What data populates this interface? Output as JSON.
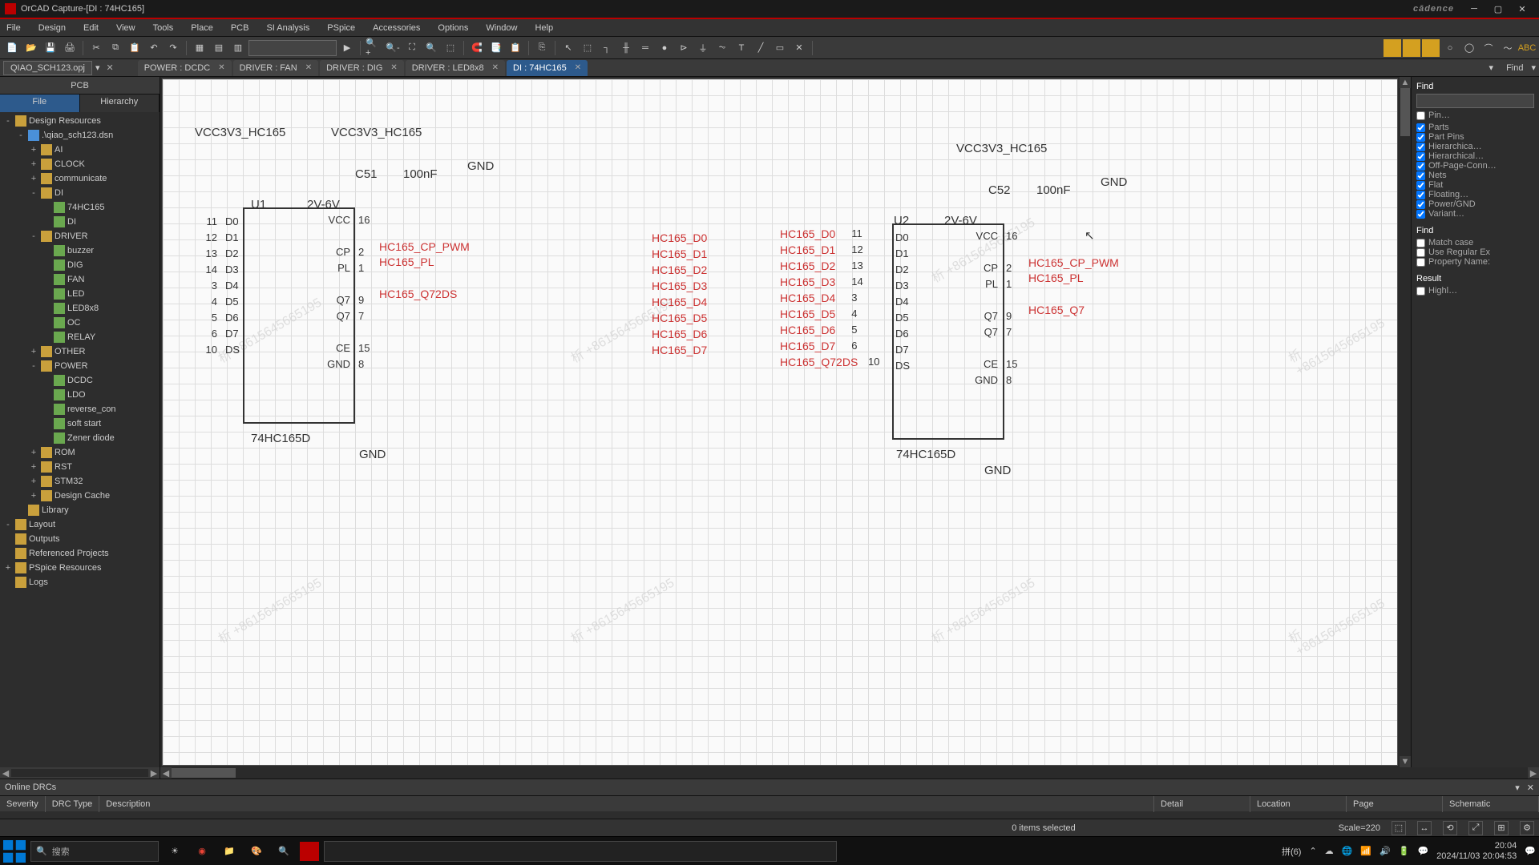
{
  "window": {
    "title": "OrCAD Capture-[DI : 74HC165]",
    "brand": "cādence"
  },
  "menu": [
    "File",
    "Design",
    "Edit",
    "View",
    "Tools",
    "Place",
    "PCB",
    "SI Analysis",
    "PSpice",
    "Accessories",
    "Options",
    "Window",
    "Help"
  ],
  "opj": {
    "name": "QIAO_SCH123.opj"
  },
  "tabs": [
    {
      "label": "POWER : DCDC",
      "sel": false
    },
    {
      "label": "DRIVER : FAN",
      "sel": false
    },
    {
      "label": "DRIVER : DIG",
      "sel": false
    },
    {
      "label": "DRIVER : LED8x8",
      "sel": false
    },
    {
      "label": "DI : 74HC165",
      "sel": true
    }
  ],
  "projpane": {
    "title": "PCB",
    "tab_file": "File",
    "tab_hier": "Hierarchy",
    "tree": [
      {
        "ind": 0,
        "exp": "-",
        "ico": "folder",
        "lbl": "Design Resources"
      },
      {
        "ind": 1,
        "exp": "-",
        "ico": "dsn",
        "lbl": ".\\qiao_sch123.dsn"
      },
      {
        "ind": 2,
        "exp": "+",
        "ico": "folder",
        "lbl": "AI"
      },
      {
        "ind": 2,
        "exp": "+",
        "ico": "folder",
        "lbl": "CLOCK"
      },
      {
        "ind": 2,
        "exp": "+",
        "ico": "folder",
        "lbl": "communicate"
      },
      {
        "ind": 2,
        "exp": "-",
        "ico": "folder",
        "lbl": "DI"
      },
      {
        "ind": 3,
        "exp": "",
        "ico": "page",
        "lbl": "74HC165"
      },
      {
        "ind": 3,
        "exp": "",
        "ico": "page",
        "lbl": "DI"
      },
      {
        "ind": 2,
        "exp": "-",
        "ico": "folder",
        "lbl": "DRIVER"
      },
      {
        "ind": 3,
        "exp": "",
        "ico": "page",
        "lbl": "buzzer"
      },
      {
        "ind": 3,
        "exp": "",
        "ico": "page",
        "lbl": "DIG"
      },
      {
        "ind": 3,
        "exp": "",
        "ico": "page",
        "lbl": "FAN"
      },
      {
        "ind": 3,
        "exp": "",
        "ico": "page",
        "lbl": "LED"
      },
      {
        "ind": 3,
        "exp": "",
        "ico": "page",
        "lbl": "LED8x8"
      },
      {
        "ind": 3,
        "exp": "",
        "ico": "page",
        "lbl": "OC"
      },
      {
        "ind": 3,
        "exp": "",
        "ico": "page",
        "lbl": "RELAY"
      },
      {
        "ind": 2,
        "exp": "+",
        "ico": "folder",
        "lbl": "OTHER"
      },
      {
        "ind": 2,
        "exp": "-",
        "ico": "folder",
        "lbl": "POWER"
      },
      {
        "ind": 3,
        "exp": "",
        "ico": "page",
        "lbl": "DCDC"
      },
      {
        "ind": 3,
        "exp": "",
        "ico": "page",
        "lbl": "LDO"
      },
      {
        "ind": 3,
        "exp": "",
        "ico": "page",
        "lbl": "reverse_con"
      },
      {
        "ind": 3,
        "exp": "",
        "ico": "page",
        "lbl": "soft start"
      },
      {
        "ind": 3,
        "exp": "",
        "ico": "page",
        "lbl": "Zener diode"
      },
      {
        "ind": 2,
        "exp": "+",
        "ico": "folder",
        "lbl": "ROM"
      },
      {
        "ind": 2,
        "exp": "+",
        "ico": "folder",
        "lbl": "RST"
      },
      {
        "ind": 2,
        "exp": "+",
        "ico": "folder",
        "lbl": "STM32"
      },
      {
        "ind": 2,
        "exp": "+",
        "ico": "folder",
        "lbl": "Design Cache"
      },
      {
        "ind": 1,
        "exp": "",
        "ico": "folder",
        "lbl": "Library"
      },
      {
        "ind": 0,
        "exp": "-",
        "ico": "folder",
        "lbl": "Layout"
      },
      {
        "ind": 0,
        "exp": "",
        "ico": "folder",
        "lbl": "Outputs"
      },
      {
        "ind": 0,
        "exp": "",
        "ico": "folder",
        "lbl": "Referenced Projects"
      },
      {
        "ind": 0,
        "exp": "+",
        "ico": "folder",
        "lbl": "PSpice Resources"
      },
      {
        "ind": 0,
        "exp": "",
        "ico": "folder",
        "lbl": "Logs"
      }
    ]
  },
  "find_header": "Find",
  "find": {
    "title": "Find",
    "pin": "Pin…",
    "checks": [
      "Parts",
      "Part Pins",
      "Hierarchica…",
      "Hierarchical…",
      "Off-Page-Conn…",
      "Nets",
      "Flat",
      "Floating…",
      "Power/GND",
      "Variant…"
    ],
    "title2": "Find",
    "opts": [
      "Match case",
      "Use Regular Ex",
      "Property Name:"
    ],
    "title3": "Result",
    "res": "Highl…"
  },
  "drc": {
    "title": "Online DRCs",
    "cols": [
      "Severity",
      "DRC Type",
      "Description",
      "Detail",
      "Location",
      "Page",
      "Schematic"
    ]
  },
  "status": {
    "sel": "0 items selected",
    "scale": "Scale=220"
  },
  "sch": {
    "pwr_u1": "VCC3V3_HC165",
    "pwr_c1": "VCC3V3_HC165",
    "pwr_u2": "VCC3V3_HC165",
    "c51": "C51",
    "c51v": "100nF",
    "gnd1": "GND",
    "c52": "C52",
    "c52v": "100nF",
    "gnd2": "GND",
    "u1": "U1",
    "u1v": "2V-6V",
    "u1part": "74HC165D",
    "u1gnd": "GND",
    "u2": "U2",
    "u2v": "2V-6V",
    "u2part": "74HC165D",
    "u2gnd": "GND",
    "u1pins_l": [
      [
        "11",
        "D0"
      ],
      [
        "12",
        "D1"
      ],
      [
        "13",
        "D2"
      ],
      [
        "14",
        "D3"
      ],
      [
        "3",
        "D4"
      ],
      [
        "4",
        "D5"
      ],
      [
        "5",
        "D6"
      ],
      [
        "6",
        "D7"
      ],
      [
        "10",
        "DS"
      ]
    ],
    "u1pins_r": [
      [
        "16",
        "VCC"
      ],
      [
        "2",
        "CP"
      ],
      [
        "1",
        "PL"
      ],
      [
        "9",
        "Q7"
      ],
      [
        "7",
        "Q7"
      ],
      [
        "15",
        "CE"
      ],
      [
        "8",
        "GND"
      ]
    ],
    "u2pins_l": [
      [
        "11",
        "D0"
      ],
      [
        "12",
        "D1"
      ],
      [
        "13",
        "D2"
      ],
      [
        "14",
        "D3"
      ],
      [
        "3",
        "D4"
      ],
      [
        "4",
        "D5"
      ],
      [
        "5",
        "D6"
      ],
      [
        "6",
        "D7"
      ],
      [
        "10",
        "DS"
      ]
    ],
    "u2pins_r": [
      [
        "16",
        "VCC"
      ],
      [
        "2",
        "CP"
      ],
      [
        "1",
        "PL"
      ],
      [
        "9",
        "Q7"
      ],
      [
        "7",
        "Q7"
      ],
      [
        "15",
        "CE"
      ],
      [
        "8",
        "GND"
      ]
    ],
    "nets_u1r": [
      "HC165_CP_PWM",
      "HC165_PL",
      "HC165_Q72DS"
    ],
    "nets_u2r": [
      "HC165_CP_PWM",
      "HC165_PL",
      "HC165_Q7"
    ],
    "nets_mid_l": [
      "HC165_D0",
      "HC165_D1",
      "HC165_D2",
      "HC165_D3",
      "HC165_D4",
      "HC165_D5",
      "HC165_D6",
      "HC165_D7"
    ],
    "nets_mid_r": [
      "HC165_D0",
      "HC165_D1",
      "HC165_D2",
      "HC165_D3",
      "HC165_D4",
      "HC165_D5",
      "HC165_D6",
      "HC165_D7"
    ],
    "net_ds": "HC165_Q72DS"
  },
  "taskbar": {
    "search": "搜索",
    "ime": "拼(6)",
    "time": "20:04",
    "date": "2024/11/03 20:04:53"
  }
}
